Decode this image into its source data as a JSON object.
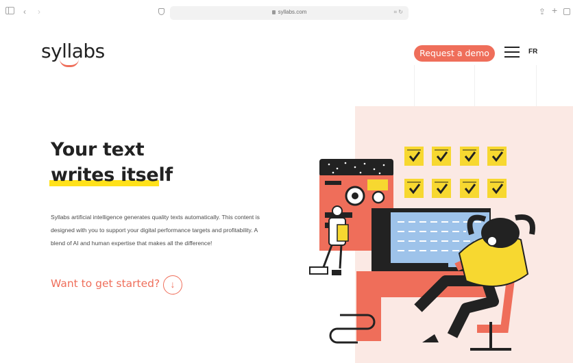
{
  "browser": {
    "url": "syllabs.com",
    "back_glyph": "‹",
    "forward_glyph": "›",
    "share_glyph": "⇪",
    "plus_glyph": "+",
    "tools_glyph": "⌗ ↻"
  },
  "header": {
    "logo_text": "syllabs",
    "demo_button": "Request a demo",
    "lang": "FR"
  },
  "hero": {
    "title_line1": "Your text",
    "title_line2": "writes itself",
    "description": "Syllabs artificial intelligence generates quality texts automatically. This content is designed with you to support your digital performance targets and profitability. A blend of AI and human expertise that makes all the difference!",
    "cta_text": "Want to get started?",
    "cta_arrow": "↓"
  },
  "colors": {
    "accent": "#ef6e5a",
    "highlight": "#ffe11a",
    "illustration_bg": "#fbe9e4",
    "dark": "#222222",
    "board": "#9ec3ea",
    "note": "#f7d830"
  },
  "icons": [
    "sidebar-icon",
    "back-icon",
    "forward-icon",
    "shield-icon",
    "lock-icon",
    "share-icon",
    "plus-icon",
    "tabs-icon",
    "menu-icon",
    "arrow-down-icon"
  ]
}
